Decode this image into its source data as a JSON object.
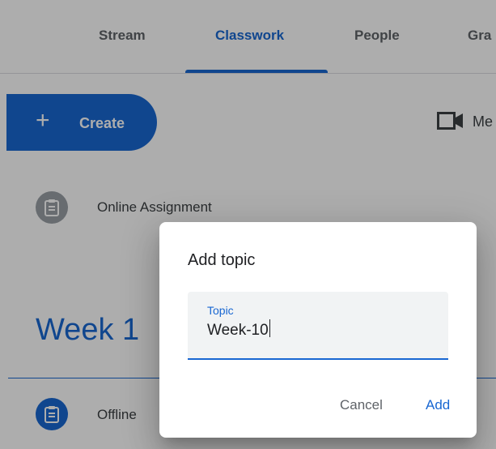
{
  "tabs": [
    {
      "label": "Stream",
      "active": false
    },
    {
      "label": "Classwork",
      "active": true
    },
    {
      "label": "People",
      "active": false
    },
    {
      "label": "Gra",
      "active": false
    }
  ],
  "toolbar": {
    "create_label": "Create",
    "meet_label": "Me"
  },
  "items": [
    {
      "title": "Online Assignment",
      "icon": "assignment-icon"
    },
    {
      "title": "Offline ",
      "icon": "assignment-icon"
    }
  ],
  "topic_section": {
    "title": "Week 1"
  },
  "dialog": {
    "title": "Add topic",
    "field_label": "Topic",
    "field_value": "Week-10",
    "cancel_label": "Cancel",
    "add_label": "Add"
  },
  "colors": {
    "accent": "#1967d2",
    "scrim": "rgba(0,0,0,0.32)",
    "gray_icon": "#9aa0a6"
  }
}
